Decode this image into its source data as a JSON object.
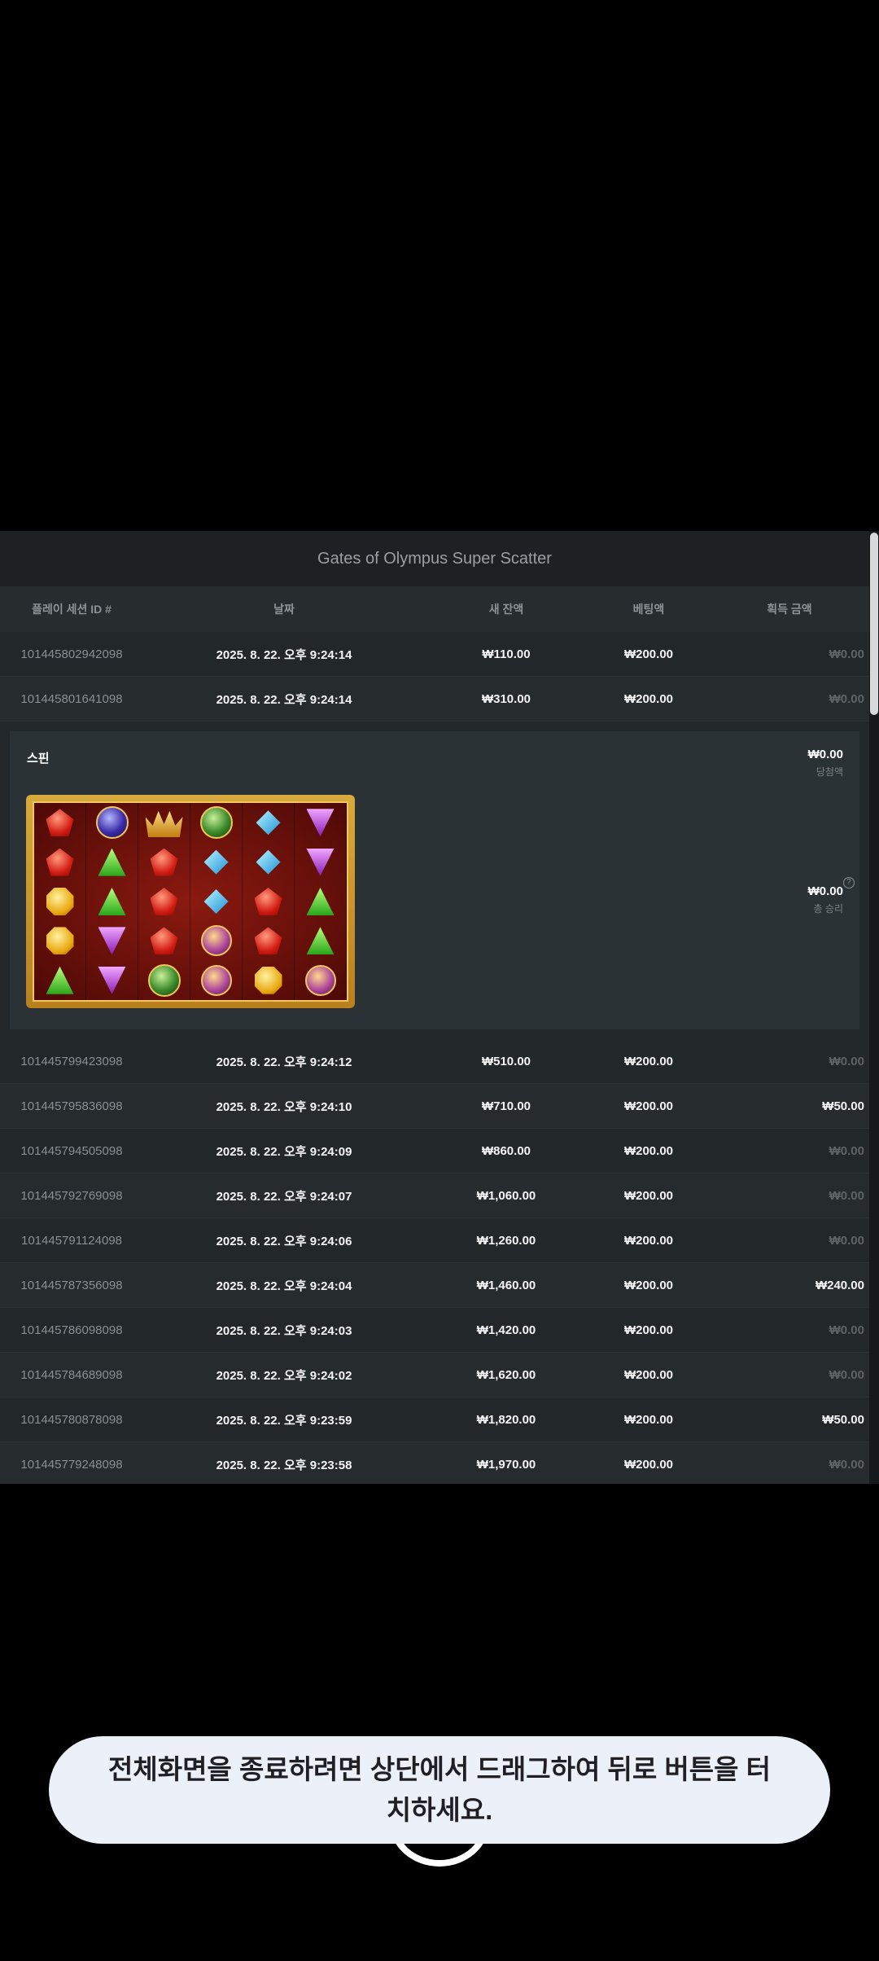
{
  "title": "Gates of Olympus Super Scatter",
  "headers": {
    "session_id": "플레이 세션 ID #",
    "date": "날짜",
    "balance": "새 잔액",
    "bet": "베팅액",
    "win": "획득 금액"
  },
  "rows_top": [
    {
      "id": "101445802942098",
      "date": "2025. 8. 22. 오후 9:24:14",
      "balance": "₩110.00",
      "bet": "₩200.00",
      "win": "₩0.00"
    },
    {
      "id": "101445801641098",
      "date": "2025. 8. 22. 오후 9:24:14",
      "balance": "₩310.00",
      "bet": "₩200.00",
      "win": "₩0.00"
    }
  ],
  "detail": {
    "spin_label": "스핀",
    "win_amount": "₩0.00",
    "win_label": "당첨액",
    "total_win_amount": "₩0.00",
    "total_win_label": "총 승리",
    "help_icon": "?",
    "symbols": [
      [
        "red",
        "hourglass",
        "crown",
        "ring",
        "blue",
        "purple"
      ],
      [
        "red",
        "green",
        "red",
        "blue",
        "blue",
        "purple"
      ],
      [
        "yellow",
        "green",
        "red",
        "blue",
        "red",
        "green"
      ],
      [
        "yellow",
        "purple",
        "red",
        "chalice",
        "red",
        "green"
      ],
      [
        "green",
        "purple",
        "ring",
        "chalice",
        "yellow",
        "chalice"
      ]
    ]
  },
  "rows_bottom": [
    {
      "id": "101445799423098",
      "date": "2025. 8. 22. 오후 9:24:12",
      "balance": "₩510.00",
      "bet": "₩200.00",
      "win": "₩0.00"
    },
    {
      "id": "101445795836098",
      "date": "2025. 8. 22. 오후 9:24:10",
      "balance": "₩710.00",
      "bet": "₩200.00",
      "win": "₩50.00"
    },
    {
      "id": "101445794505098",
      "date": "2025. 8. 22. 오후 9:24:09",
      "balance": "₩860.00",
      "bet": "₩200.00",
      "win": "₩0.00"
    },
    {
      "id": "101445792769098",
      "date": "2025. 8. 22. 오후 9:24:07",
      "balance": "₩1,060.00",
      "bet": "₩200.00",
      "win": "₩0.00"
    },
    {
      "id": "101445791124098",
      "date": "2025. 8. 22. 오후 9:24:06",
      "balance": "₩1,260.00",
      "bet": "₩200.00",
      "win": "₩0.00"
    },
    {
      "id": "101445787356098",
      "date": "2025. 8. 22. 오후 9:24:04",
      "balance": "₩1,460.00",
      "bet": "₩200.00",
      "win": "₩240.00"
    },
    {
      "id": "101445786098098",
      "date": "2025. 8. 22. 오후 9:24:03",
      "balance": "₩1,420.00",
      "bet": "₩200.00",
      "win": "₩0.00"
    },
    {
      "id": "101445784689098",
      "date": "2025. 8. 22. 오후 9:24:02",
      "balance": "₩1,620.00",
      "bet": "₩200.00",
      "win": "₩0.00"
    },
    {
      "id": "101445780878098",
      "date": "2025. 8. 22. 오후 9:23:59",
      "balance": "₩1,820.00",
      "bet": "₩200.00",
      "win": "₩50.00"
    },
    {
      "id": "101445779248098",
      "date": "2025. 8. 22. 오후 9:23:58",
      "balance": "₩1,970.00",
      "bet": "₩200.00",
      "win": "₩0.00"
    }
  ],
  "toast": "전체화면을 종료하려면 상단에서 드래그하여 뒤로 버튼을 터치하세요."
}
